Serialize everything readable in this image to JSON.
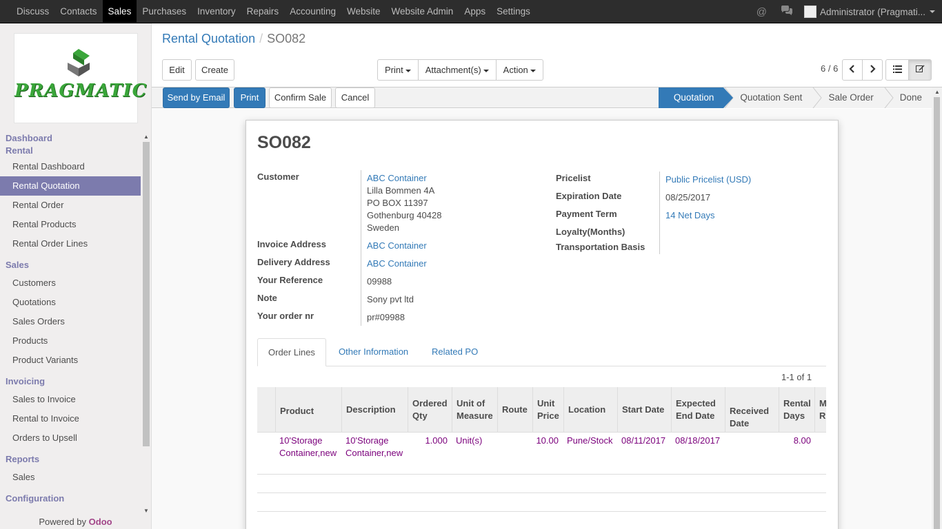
{
  "topbar": {
    "menu": [
      "Discuss",
      "Contacts",
      "Sales",
      "Purchases",
      "Inventory",
      "Repairs",
      "Accounting",
      "Website",
      "Website Admin",
      "Apps",
      "Settings"
    ],
    "active": "Sales",
    "user": "Administrator (Pragmati..."
  },
  "logo": {
    "text": "PRAGMATIC"
  },
  "sidebar": {
    "sections": [
      {
        "title": "Dashboard",
        "items": []
      },
      {
        "title": "Rental",
        "items": [
          "Rental Dashboard",
          "Rental Quotation",
          "Rental Order",
          "Rental Products",
          "Rental Order Lines"
        ]
      },
      {
        "title": "Sales",
        "items": [
          "Customers",
          "Quotations",
          "Sales Orders",
          "Products",
          "Product Variants"
        ]
      },
      {
        "title": "Invoicing",
        "items": [
          "Sales to Invoice",
          "Rental to Invoice",
          "Orders to Upsell"
        ]
      },
      {
        "title": "Reports",
        "items": [
          "Sales"
        ]
      },
      {
        "title": "Configuration",
        "items": []
      }
    ],
    "active_item": "Rental Quotation",
    "powered_prefix": "Powered by ",
    "powered_brand": "Odoo"
  },
  "breadcrumb": {
    "parent": "Rental Quotation",
    "separator": "/",
    "current": "SO082"
  },
  "controls": {
    "edit": "Edit",
    "create": "Create",
    "print": "Print",
    "attachments": "Attachment(s)",
    "action": "Action",
    "pager": "6 / 6"
  },
  "statusbar": {
    "send_email": "Send by Email",
    "print": "Print",
    "confirm": "Confirm Sale",
    "cancel": "Cancel",
    "stages": [
      "Quotation",
      "Quotation Sent",
      "Sale Order",
      "Done"
    ],
    "active_stage": "Quotation"
  },
  "form": {
    "name": "SO082",
    "customer_label": "Customer",
    "customer_name": "ABC Container",
    "customer_address": [
      "Lilla Bommen 4A",
      "PO BOX 11397",
      "Gothenburg 40428",
      "Sweden"
    ],
    "invoice_address_label": "Invoice Address",
    "invoice_address": "ABC Container",
    "delivery_address_label": "Delivery Address",
    "delivery_address": "ABC Container",
    "your_reference_label": "Your Reference",
    "your_reference": "09988",
    "note_label": "Note",
    "note": "Sony pvt ltd",
    "order_nr_label": "Your order nr",
    "order_nr": "pr#09988",
    "pricelist_label": "Pricelist",
    "pricelist": "Public Pricelist (USD)",
    "expiration_label": "Expiration Date",
    "expiration": "08/25/2017",
    "payment_term_label": "Payment Term",
    "payment_term": "14 Net Days",
    "loyalty_label": "Loyalty(Months)",
    "transport_label": "Transportation Basis"
  },
  "tabs": [
    "Order Lines",
    "Other Information",
    "Related PO"
  ],
  "active_tab": "Order Lines",
  "table": {
    "pager": "1-1 of 1",
    "headers": {
      "product": "Product",
      "description": "Description",
      "ordered_qty": [
        "Ordered",
        "Qty"
      ],
      "uom": [
        "Unit of",
        "Measure"
      ],
      "route": "Route",
      "unit_price": [
        "Unit",
        "Price"
      ],
      "location": "Location",
      "start_date": "Start Date",
      "expected_end": [
        "Expected",
        "End Date"
      ],
      "received": [
        "Received",
        "Date"
      ],
      "rental_days": [
        "Rental",
        "Days"
      ],
      "more": [
        "M",
        "R"
      ]
    },
    "rows": [
      {
        "product": [
          "10'Storage",
          "Container,new"
        ],
        "description": [
          "10'Storage",
          "Container,new"
        ],
        "ordered_qty": "1.000",
        "uom": "Unit(s)",
        "route": "",
        "unit_price": "10.00",
        "location": "Pune/Stock",
        "start_date": "08/11/2017",
        "expected_end": "08/18/2017",
        "received": "",
        "rental_days": "8.00"
      }
    ]
  }
}
